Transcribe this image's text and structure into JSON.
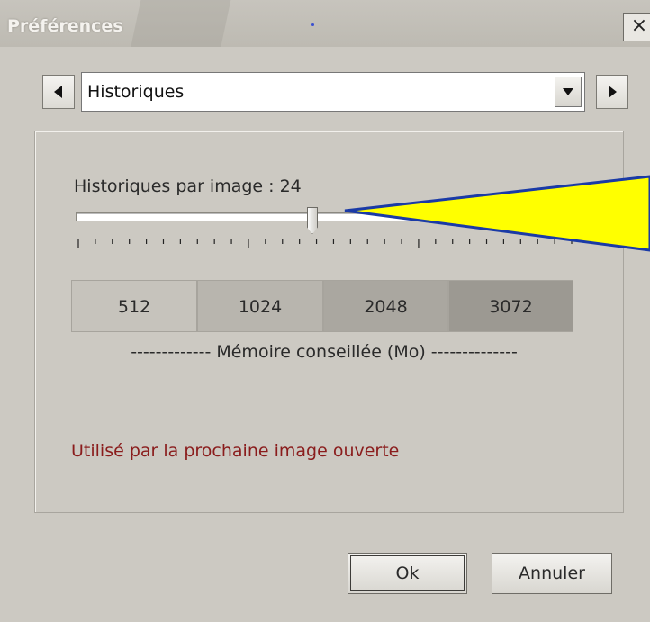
{
  "window": {
    "title": "Préférences",
    "close_label": "×"
  },
  "nav": {
    "prev_icon": "triangle-left-icon",
    "next_icon": "triangle-right-icon",
    "selected_section": "Historiques"
  },
  "slider": {
    "label": "Historiques par image : 24",
    "value": 24
  },
  "memory": {
    "options": [
      "512",
      "1024",
      "2048",
      "3072"
    ],
    "caption": "------------- Mémoire conseillée (Mo) --------------"
  },
  "notice": {
    "text": "Utilisé par la prochaine image ouverte",
    "color": "#8a1c1c"
  },
  "buttons": {
    "ok": "Ok",
    "cancel": "Annuler"
  },
  "annotation": {
    "callout_color": "#ffff00",
    "outline_color": "#1a3aa6"
  }
}
